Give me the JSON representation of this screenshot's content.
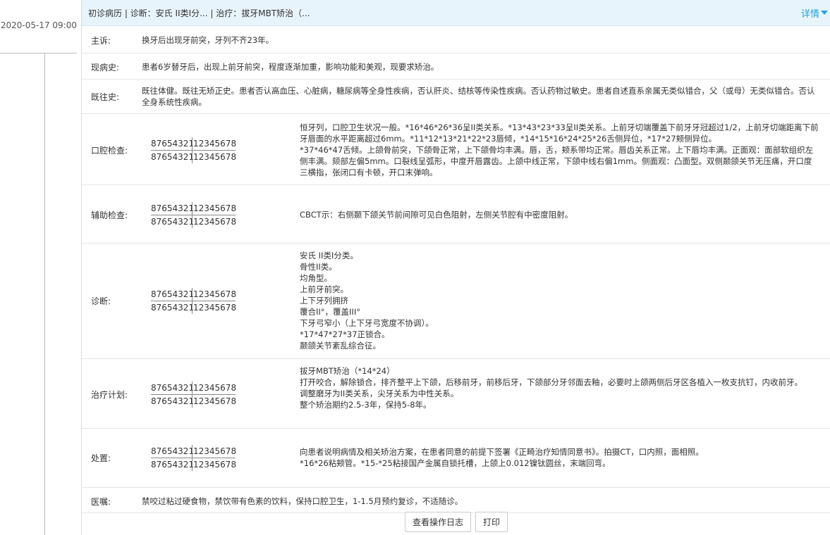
{
  "timeline": {
    "date": "2020-05-17 09:00"
  },
  "header": {
    "title": "初诊病历 | 诊断：安氏 II类I分... | 治疗：拔牙MBT矫治（...",
    "detail_label": "详情"
  },
  "tooth_chart": {
    "upper_left": "87654321",
    "upper_right": "12345678",
    "lower_left": "87654321",
    "lower_right": "12345678"
  },
  "rows": {
    "chief": {
      "label": "主诉:",
      "value": "换牙后出现牙前突，牙列不齐23年。"
    },
    "present": {
      "label": "现病史:",
      "value": "患者6岁替牙后，出现上前牙前突，程度逐渐加重，影响功能和美观，现要求矫治。"
    },
    "past": {
      "label": "既往史:",
      "value": "既往体健。既往无矫正史。患者否认高血压、心脏病，糖尿病等全身性疾病，否认肝炎、结核等传染性疾病。否认药物过敏史。患者自述直系亲属无类似错合，父（或母）无类似错合。否认全身系统性疾病。"
    },
    "oral": {
      "label": "口腔检查:",
      "value": "恒牙列，口腔卫生状况一般。*16*46*26*36呈II类关系。*13*43*23*33呈II类关系。上前牙切端覆盖下前牙牙冠超过1/2，上前牙切端距离下前牙唇面的水平距离超过6mm。*11*12*13*21*22*23唇倾，*14*15*16*24*25*26舌侧异位，*17*27颊侧异位。\n*37*46*47舌倾。上颌骨前突，下颌骨正常，上下颌骨均丰满。唇，舌，颊系带均正常。唇齿关系正常。上下唇均丰满。正面观：面部软组织左侧丰满。颏部左偏5mm。口裂线呈弧形，中度开唇露齿。上颌中线正常，下颌中线右偏1mm。侧面观：凸面型。双侧颞颌关节无压痛，开口度三横指，张闭口有卡顿，开口末弹响。"
    },
    "aux": {
      "label": "辅助检查:",
      "value": "CBCT示：右侧颞下颌关节前间隙可见白色阻射，左侧关节腔有中密度阻射。"
    },
    "diag": {
      "label": "诊断:",
      "value": "安氏 II类I分类。\n骨性II类。\n均角型。\n上前牙前突。\n上下牙列拥挤\n覆合II°，覆盖III°\n下牙弓窄小（上下牙弓宽度不协调）。\n*17*47*27*37正锁合。\n颞颌关节紊乱综合征。"
    },
    "plan": {
      "label": "治疗计划:",
      "value": "拔牙MBT矫治（*14*24）\n打开咬合，解除锁合，排齐整平上下颌，后移前牙，前移后牙，下颌部分牙邻面去釉，必要时上颌两侧后牙区各植入一枚支抗钉，内收前牙。\n调整磨牙为II类关系，尖牙关系为中性关系。\n整个矫治期约2.5-3年，保持5-8年。"
    },
    "treat": {
      "label": "处置:",
      "value": "向患者说明病情及相关矫治方案，在患者同意的前提下签署《正畸治疗知情同意书》。拍摄CT，口内照，面相照。\n*16*26粘颊管。*15-*25粘接国产金属自锁托槽，上颌上0.012镍钛圆丝，末端回弯。"
    },
    "advice": {
      "label": "医嘱:",
      "value": "禁咬过粘过硬食物，禁饮带有色素的饮料，保持口腔卫生，1-1.5月预约复诊，不适随诊。"
    }
  },
  "buttons": {
    "log": "查看操作日志",
    "print": "打印"
  }
}
